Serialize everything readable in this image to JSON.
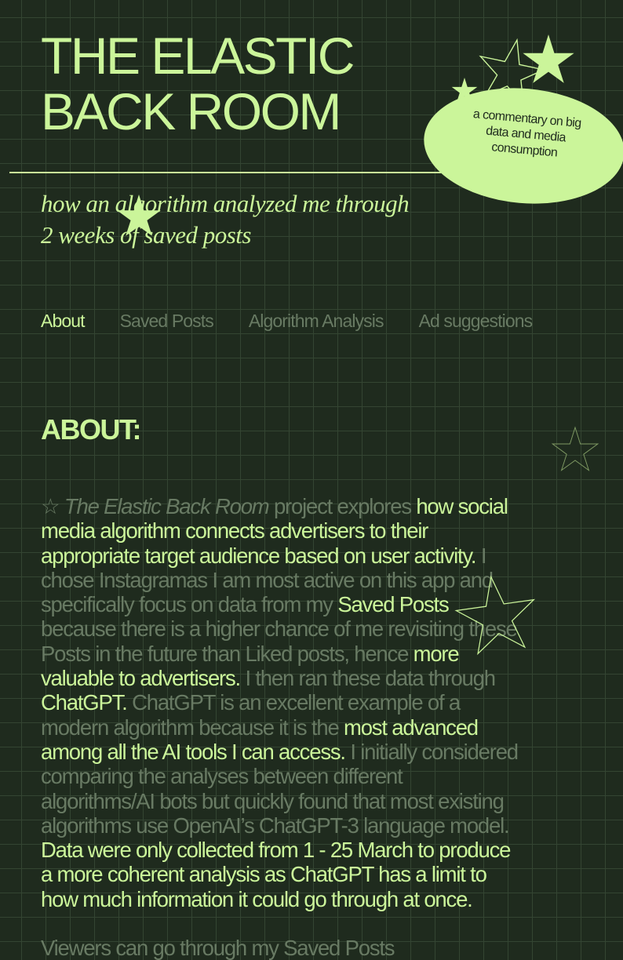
{
  "header": {
    "title_line1": "THE ELASTIC",
    "title_line2": "BACK ROOM",
    "subtitle_line1": "how an algorithm analyzed me through",
    "subtitle_line2": "2 weeks of saved posts",
    "badge_line1": "a commentary on big",
    "badge_line2": "data and media",
    "badge_line3": "consumption"
  },
  "nav": {
    "items": [
      {
        "label": "About"
      },
      {
        "label": "Saved Posts"
      },
      {
        "label": "Algorithm Analysis"
      },
      {
        "label": "Ad suggestions"
      }
    ]
  },
  "about": {
    "heading": "ABOUT:",
    "lines": [
      [
        {
          "t": "☆ "
        },
        {
          "t": "The Elastic Back Room",
          "s": "it"
        },
        {
          "t": " project explores "
        },
        {
          "t": "how social",
          "s": "hl"
        }
      ],
      [
        {
          "t": "media algorithm connects advertisers to their",
          "s": "hl"
        }
      ],
      [
        {
          "t": "appropriate target audience based on user activity.",
          "s": "hl"
        },
        {
          "t": " I"
        }
      ],
      [
        {
          "t": "chose Instagramas I am most active on this app and"
        }
      ],
      [
        {
          "t": "specifically focus on data from my "
        },
        {
          "t": "Saved Posts",
          "s": "hl"
        }
      ],
      [
        {
          "t": "because there is a higher chance of me revisiting these"
        }
      ],
      [
        {
          "t": "Posts in the future than Liked posts, hence "
        },
        {
          "t": "more",
          "s": "hl"
        }
      ],
      [
        {
          "t": "valuable to advertisers.",
          "s": "hl"
        },
        {
          "t": " I then ran these data through"
        }
      ],
      [
        {
          "t": "ChatGPT.",
          "s": "hl"
        },
        {
          "t": " ChatGPT is an excellent example of a"
        }
      ],
      [
        {
          "t": "modern algorithm because it is the "
        },
        {
          "t": "most advanced",
          "s": "hl"
        }
      ],
      [
        {
          "t": "among all the AI tools I can access.",
          "s": "hl"
        },
        {
          "t": " I initially considered"
        }
      ],
      [
        {
          "t": "comparing the analyses between different"
        }
      ],
      [
        {
          "t": "algorithms/AI bots but quickly found that most existing"
        }
      ],
      [
        {
          "t": "algorithms use OpenAI’s ChatGPT-3 language model."
        }
      ],
      [
        {
          "t": "Data were only collected from 1 - 25 March to produce",
          "s": "hl"
        }
      ],
      [
        {
          "t": "a more coherent analysis as ChatGPT has a limit to",
          "s": "hl"
        }
      ],
      [
        {
          "t": "how much information it could go through at once.",
          "s": "hl"
        }
      ]
    ],
    "tail": "Viewers can go through my Saved Posts"
  },
  "icons": [
    "star-icon"
  ],
  "colors": {
    "background": "#1f2b1e",
    "accent": "#cbf59a",
    "muted": "#687a63",
    "grid": "#344532"
  }
}
